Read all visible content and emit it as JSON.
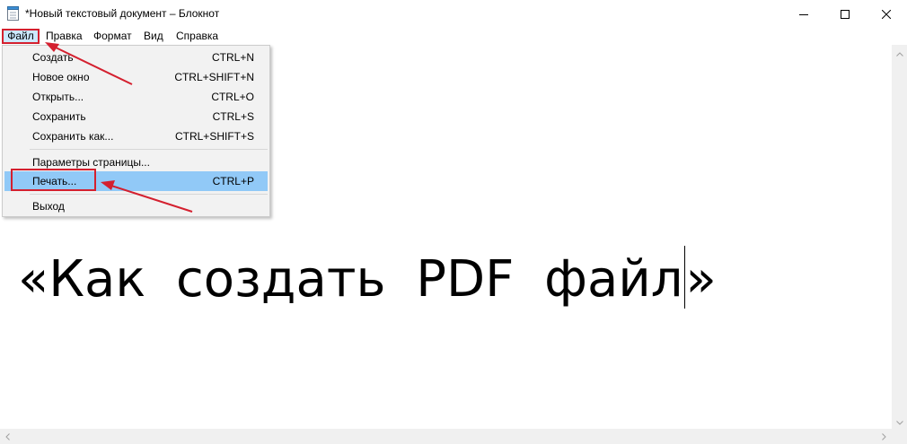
{
  "window": {
    "title": "*Новый текстовый документ – Блокнот",
    "controls": {
      "minimize": "minimize-icon",
      "maximize": "maximize-icon",
      "close": "close-icon"
    }
  },
  "menubar": {
    "items": [
      {
        "label": "Файл"
      },
      {
        "label": "Правка"
      },
      {
        "label": "Формат"
      },
      {
        "label": "Вид"
      },
      {
        "label": "Справка"
      }
    ]
  },
  "file_menu": {
    "items": [
      {
        "label": "Создать",
        "shortcut": "CTRL+N"
      },
      {
        "label": "Новое окно",
        "shortcut": "CTRL+SHIFT+N"
      },
      {
        "label": "Открыть...",
        "shortcut": "CTRL+O"
      },
      {
        "label": "Сохранить",
        "shortcut": "CTRL+S"
      },
      {
        "label": "Сохранить как...",
        "shortcut": "CTRL+SHIFT+S"
      },
      {
        "label": "Параметры страницы...",
        "shortcut": ""
      },
      {
        "label": "Печать...",
        "shortcut": "CTRL+P"
      },
      {
        "label": "Выход",
        "shortcut": ""
      }
    ],
    "highlighted": "Печать..."
  },
  "editor": {
    "text_before_caret": "«Как создать PDF файл",
    "text_after_caret": "»"
  },
  "colors": {
    "highlight": "#91c9f7",
    "menu_bg": "#f2f2f2",
    "annotation": "#d4202f"
  }
}
